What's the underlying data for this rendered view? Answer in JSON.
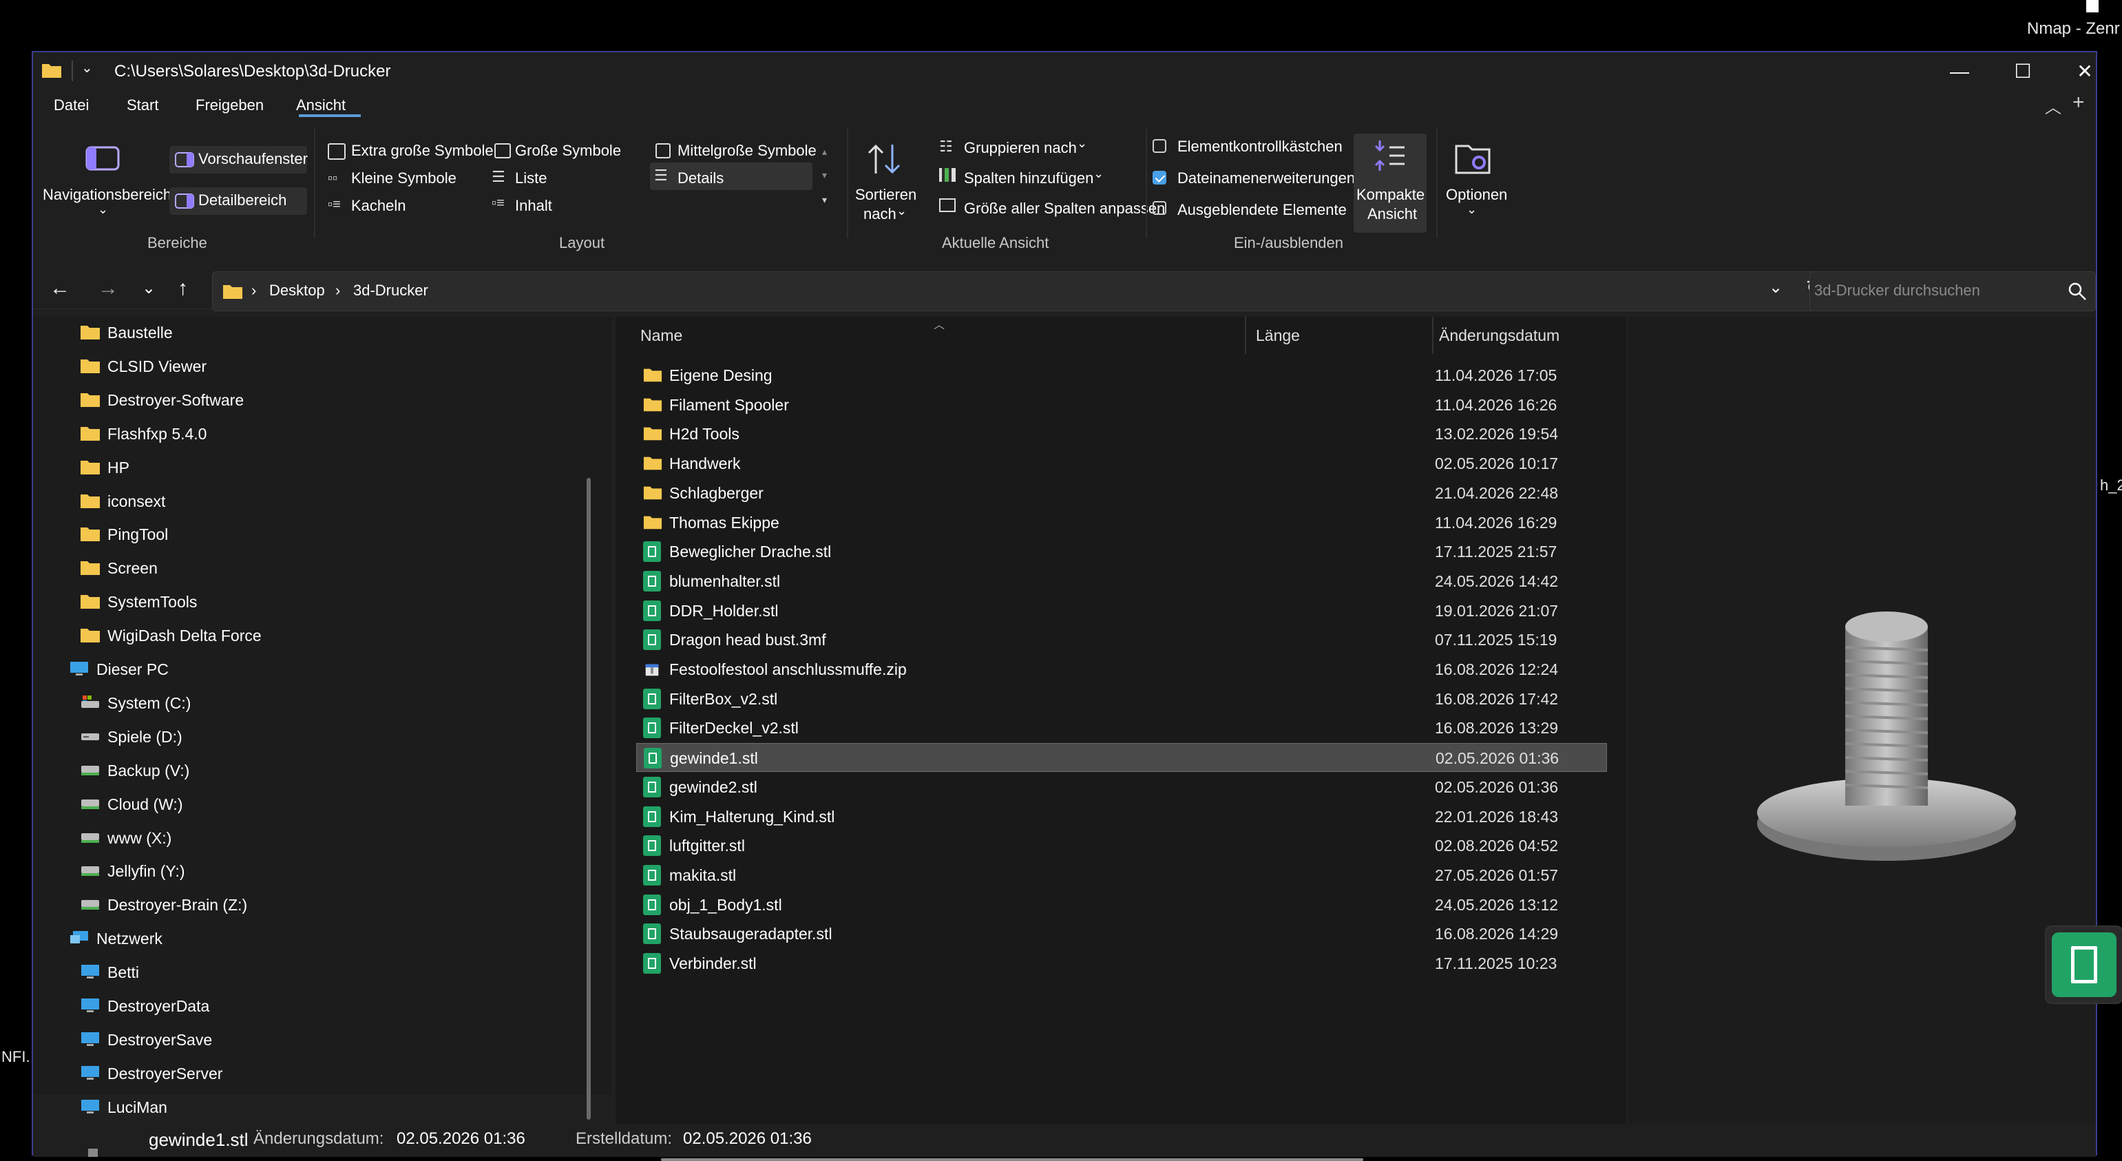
{
  "desktop": {
    "top_right_text": "Nmap - Zenr",
    "left_edge_text": "NFI.",
    "right_edge_text": "h_2."
  },
  "window": {
    "title": "C:\\Users\\Solares\\Desktop\\3d-Drucker",
    "minimize": "—",
    "maximize": "☐",
    "close": "✕"
  },
  "menu": {
    "items": [
      "Datei",
      "Start",
      "Freigeben",
      "Ansicht"
    ],
    "active": "Ansicht"
  },
  "ribbon": {
    "bereiche": {
      "navigationsbereich": "Navigationsbereich",
      "vorschaufenster": "Vorschaufenster",
      "detailbereich": "Detailbereich",
      "group_label": "Bereiche"
    },
    "layout": {
      "extra_grosse_symbole": "Extra große Symbole",
      "grosse_symbole": "Große Symbole",
      "mittelgrosse_symbole": "Mittelgroße Symbole",
      "kleine_symbole": "Kleine Symbole",
      "liste": "Liste",
      "details": "Details",
      "kacheln": "Kacheln",
      "inhalt": "Inhalt",
      "group_label": "Layout"
    },
    "aktuelle_ansicht": {
      "sortieren_line1": "Sortieren",
      "sortieren_line2": "nach",
      "gruppieren_nach": "Gruppieren nach",
      "spalten_hinzufuegen": "Spalten hinzufügen",
      "groesse_aller_spalten": "Größe aller Spalten anpassen",
      "group_label": "Aktuelle Ansicht"
    },
    "ein_ausblenden": {
      "elementkontrollkaestchen": "Elementkontrollkästchen",
      "elementkontrollkaestchen_checked": false,
      "dateinamenerweiterungen": "Dateinamenerweiterungen",
      "dateinamenerweiterungen_checked": true,
      "ausgeblendete_elemente": "Ausgeblendete Elemente",
      "ausgeblendete_elemente_checked": false,
      "kompakte_line1": "Kompakte",
      "kompakte_line2": "Ansicht",
      "group_label": "Ein-/ausblenden"
    },
    "optionen": "Optionen"
  },
  "address": {
    "crumbs": [
      "Desktop",
      "3d-Drucker"
    ],
    "search_placeholder": "3d-Drucker durchsuchen"
  },
  "nav_tree": [
    {
      "label": "Baustelle",
      "type": "folder",
      "indent": 1
    },
    {
      "label": "CLSID Viewer",
      "type": "folder",
      "indent": 1
    },
    {
      "label": "Destroyer-Software",
      "type": "folder",
      "indent": 1
    },
    {
      "label": "Flashfxp 5.4.0",
      "type": "folder",
      "indent": 1
    },
    {
      "label": "HP",
      "type": "folder",
      "indent": 1
    },
    {
      "label": "iconsext",
      "type": "folder",
      "indent": 1
    },
    {
      "label": "PingTool",
      "type": "folder",
      "indent": 1
    },
    {
      "label": "Screen",
      "type": "folder",
      "indent": 1
    },
    {
      "label": "SystemTools",
      "type": "folder",
      "indent": 1
    },
    {
      "label": "WigiDash Delta Force",
      "type": "folder",
      "indent": 1
    },
    {
      "label": "Dieser PC",
      "type": "pc",
      "indent": 0
    },
    {
      "label": "System (C:)",
      "type": "sysdrive",
      "indent": 1
    },
    {
      "label": "Spiele (D:)",
      "type": "drive",
      "indent": 1
    },
    {
      "label": "Backup (V:)",
      "type": "netdrive",
      "indent": 1
    },
    {
      "label": "Cloud (W:)",
      "type": "netdrive",
      "indent": 1
    },
    {
      "label": "www (X:)",
      "type": "netdrive",
      "indent": 1
    },
    {
      "label": "Jellyfin (Y:)",
      "type": "netdrive",
      "indent": 1
    },
    {
      "label": "Destroyer-Brain (Z:)",
      "type": "netdrive",
      "indent": 1
    },
    {
      "label": "Netzwerk",
      "type": "network",
      "indent": 0
    },
    {
      "label": "Betti",
      "type": "pc",
      "indent": 1
    },
    {
      "label": "DestroyerData",
      "type": "pc",
      "indent": 1
    },
    {
      "label": "DestroyerSave",
      "type": "pc",
      "indent": 1
    },
    {
      "label": "DestroyerServer",
      "type": "pc",
      "indent": 1
    },
    {
      "label": "LuciMan",
      "type": "pc",
      "indent": 1
    }
  ],
  "columns": {
    "name": "Name",
    "length": "Länge",
    "date": "Änderungsdatum"
  },
  "files": [
    {
      "name": "Eigene Desing",
      "date": "11.04.2026 17:05",
      "type": "folder"
    },
    {
      "name": "Filament Spooler",
      "date": "11.04.2026 16:26",
      "type": "folder"
    },
    {
      "name": "H2d Tools",
      "date": "13.02.2026 19:54",
      "type": "folder"
    },
    {
      "name": "Handwerk",
      "date": "02.05.2026 10:17",
      "type": "folder"
    },
    {
      "name": "Schlagberger",
      "date": "21.04.2026 22:48",
      "type": "folder"
    },
    {
      "name": "Thomas Ekippe",
      "date": "11.04.2026 16:29",
      "type": "folder"
    },
    {
      "name": "Beweglicher Drache.stl",
      "date": "17.11.2025 21:57",
      "type": "stl"
    },
    {
      "name": "blumenhalter.stl",
      "date": "24.05.2026 14:42",
      "type": "stl"
    },
    {
      "name": "DDR_Holder.stl",
      "date": "19.01.2026 21:07",
      "type": "stl"
    },
    {
      "name": "Dragon head bust.3mf",
      "date": "07.11.2025 15:19",
      "type": "stl"
    },
    {
      "name": "Festoolfestool anschlussmuffe.zip",
      "date": "16.08.2026 12:24",
      "type": "zip"
    },
    {
      "name": "FilterBox_v2.stl",
      "date": "16.08.2026 17:42",
      "type": "stl"
    },
    {
      "name": "FilterDeckel_v2.stl",
      "date": "16.08.2026 13:29",
      "type": "stl"
    },
    {
      "name": "gewinde1.stl",
      "date": "02.05.2026 01:36",
      "type": "stl",
      "selected": true
    },
    {
      "name": "gewinde2.stl",
      "date": "02.05.2026 01:36",
      "type": "stl"
    },
    {
      "name": "Kim_Halterung_Kind.stl",
      "date": "22.01.2026 18:43",
      "type": "stl"
    },
    {
      "name": "luftgitter.stl",
      "date": "02.08.2026 04:52",
      "type": "stl"
    },
    {
      "name": "makita.stl",
      "date": "27.05.2026 01:57",
      "type": "stl"
    },
    {
      "name": "obj_1_Body1.stl",
      "date": "24.05.2026 13:12",
      "type": "stl"
    },
    {
      "name": "Staubsaugeradapter.stl",
      "date": "16.08.2026 14:29",
      "type": "stl"
    },
    {
      "name": "Verbinder.stl",
      "date": "17.11.2025 10:23",
      "type": "stl"
    }
  ],
  "status": {
    "filename": "gewinde1.stl",
    "modified_label": "Änderungsdatum:",
    "modified_value": "02.05.2026 01:36",
    "created_label": "Erstelldatum:",
    "created_value": "02.05.2026 01:36"
  },
  "colors": {
    "accent": "#5b9bd5",
    "folder": "#f4c64d",
    "stl_icon": "#21a366",
    "selection": "#4b4b4b"
  }
}
